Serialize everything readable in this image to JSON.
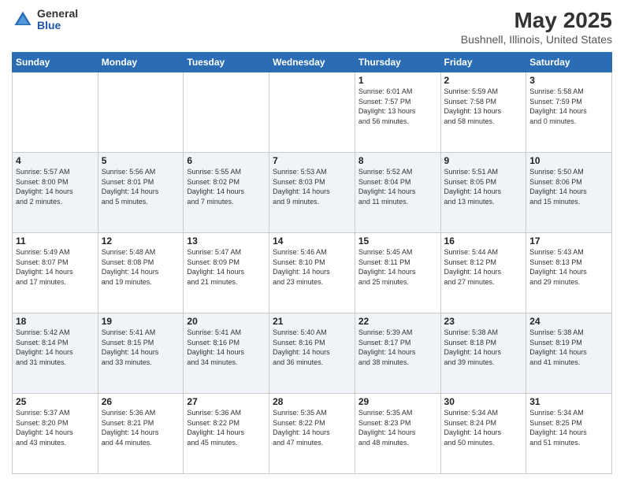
{
  "logo": {
    "general": "General",
    "blue": "Blue"
  },
  "title": "May 2025",
  "subtitle": "Bushnell, Illinois, United States",
  "days": [
    "Sunday",
    "Monday",
    "Tuesday",
    "Wednesday",
    "Thursday",
    "Friday",
    "Saturday"
  ],
  "weeks": [
    [
      {
        "day": "",
        "info": ""
      },
      {
        "day": "",
        "info": ""
      },
      {
        "day": "",
        "info": ""
      },
      {
        "day": "",
        "info": ""
      },
      {
        "day": "1",
        "info": "Sunrise: 6:01 AM\nSunset: 7:57 PM\nDaylight: 13 hours\nand 56 minutes."
      },
      {
        "day": "2",
        "info": "Sunrise: 5:59 AM\nSunset: 7:58 PM\nDaylight: 13 hours\nand 58 minutes."
      },
      {
        "day": "3",
        "info": "Sunrise: 5:58 AM\nSunset: 7:59 PM\nDaylight: 14 hours\nand 0 minutes."
      }
    ],
    [
      {
        "day": "4",
        "info": "Sunrise: 5:57 AM\nSunset: 8:00 PM\nDaylight: 14 hours\nand 2 minutes."
      },
      {
        "day": "5",
        "info": "Sunrise: 5:56 AM\nSunset: 8:01 PM\nDaylight: 14 hours\nand 5 minutes."
      },
      {
        "day": "6",
        "info": "Sunrise: 5:55 AM\nSunset: 8:02 PM\nDaylight: 14 hours\nand 7 minutes."
      },
      {
        "day": "7",
        "info": "Sunrise: 5:53 AM\nSunset: 8:03 PM\nDaylight: 14 hours\nand 9 minutes."
      },
      {
        "day": "8",
        "info": "Sunrise: 5:52 AM\nSunset: 8:04 PM\nDaylight: 14 hours\nand 11 minutes."
      },
      {
        "day": "9",
        "info": "Sunrise: 5:51 AM\nSunset: 8:05 PM\nDaylight: 14 hours\nand 13 minutes."
      },
      {
        "day": "10",
        "info": "Sunrise: 5:50 AM\nSunset: 8:06 PM\nDaylight: 14 hours\nand 15 minutes."
      }
    ],
    [
      {
        "day": "11",
        "info": "Sunrise: 5:49 AM\nSunset: 8:07 PM\nDaylight: 14 hours\nand 17 minutes."
      },
      {
        "day": "12",
        "info": "Sunrise: 5:48 AM\nSunset: 8:08 PM\nDaylight: 14 hours\nand 19 minutes."
      },
      {
        "day": "13",
        "info": "Sunrise: 5:47 AM\nSunset: 8:09 PM\nDaylight: 14 hours\nand 21 minutes."
      },
      {
        "day": "14",
        "info": "Sunrise: 5:46 AM\nSunset: 8:10 PM\nDaylight: 14 hours\nand 23 minutes."
      },
      {
        "day": "15",
        "info": "Sunrise: 5:45 AM\nSunset: 8:11 PM\nDaylight: 14 hours\nand 25 minutes."
      },
      {
        "day": "16",
        "info": "Sunrise: 5:44 AM\nSunset: 8:12 PM\nDaylight: 14 hours\nand 27 minutes."
      },
      {
        "day": "17",
        "info": "Sunrise: 5:43 AM\nSunset: 8:13 PM\nDaylight: 14 hours\nand 29 minutes."
      }
    ],
    [
      {
        "day": "18",
        "info": "Sunrise: 5:42 AM\nSunset: 8:14 PM\nDaylight: 14 hours\nand 31 minutes."
      },
      {
        "day": "19",
        "info": "Sunrise: 5:41 AM\nSunset: 8:15 PM\nDaylight: 14 hours\nand 33 minutes."
      },
      {
        "day": "20",
        "info": "Sunrise: 5:41 AM\nSunset: 8:16 PM\nDaylight: 14 hours\nand 34 minutes."
      },
      {
        "day": "21",
        "info": "Sunrise: 5:40 AM\nSunset: 8:16 PM\nDaylight: 14 hours\nand 36 minutes."
      },
      {
        "day": "22",
        "info": "Sunrise: 5:39 AM\nSunset: 8:17 PM\nDaylight: 14 hours\nand 38 minutes."
      },
      {
        "day": "23",
        "info": "Sunrise: 5:38 AM\nSunset: 8:18 PM\nDaylight: 14 hours\nand 39 minutes."
      },
      {
        "day": "24",
        "info": "Sunrise: 5:38 AM\nSunset: 8:19 PM\nDaylight: 14 hours\nand 41 minutes."
      }
    ],
    [
      {
        "day": "25",
        "info": "Sunrise: 5:37 AM\nSunset: 8:20 PM\nDaylight: 14 hours\nand 43 minutes."
      },
      {
        "day": "26",
        "info": "Sunrise: 5:36 AM\nSunset: 8:21 PM\nDaylight: 14 hours\nand 44 minutes."
      },
      {
        "day": "27",
        "info": "Sunrise: 5:36 AM\nSunset: 8:22 PM\nDaylight: 14 hours\nand 45 minutes."
      },
      {
        "day": "28",
        "info": "Sunrise: 5:35 AM\nSunset: 8:22 PM\nDaylight: 14 hours\nand 47 minutes."
      },
      {
        "day": "29",
        "info": "Sunrise: 5:35 AM\nSunset: 8:23 PM\nDaylight: 14 hours\nand 48 minutes."
      },
      {
        "day": "30",
        "info": "Sunrise: 5:34 AM\nSunset: 8:24 PM\nDaylight: 14 hours\nand 50 minutes."
      },
      {
        "day": "31",
        "info": "Sunrise: 5:34 AM\nSunset: 8:25 PM\nDaylight: 14 hours\nand 51 minutes."
      }
    ]
  ]
}
